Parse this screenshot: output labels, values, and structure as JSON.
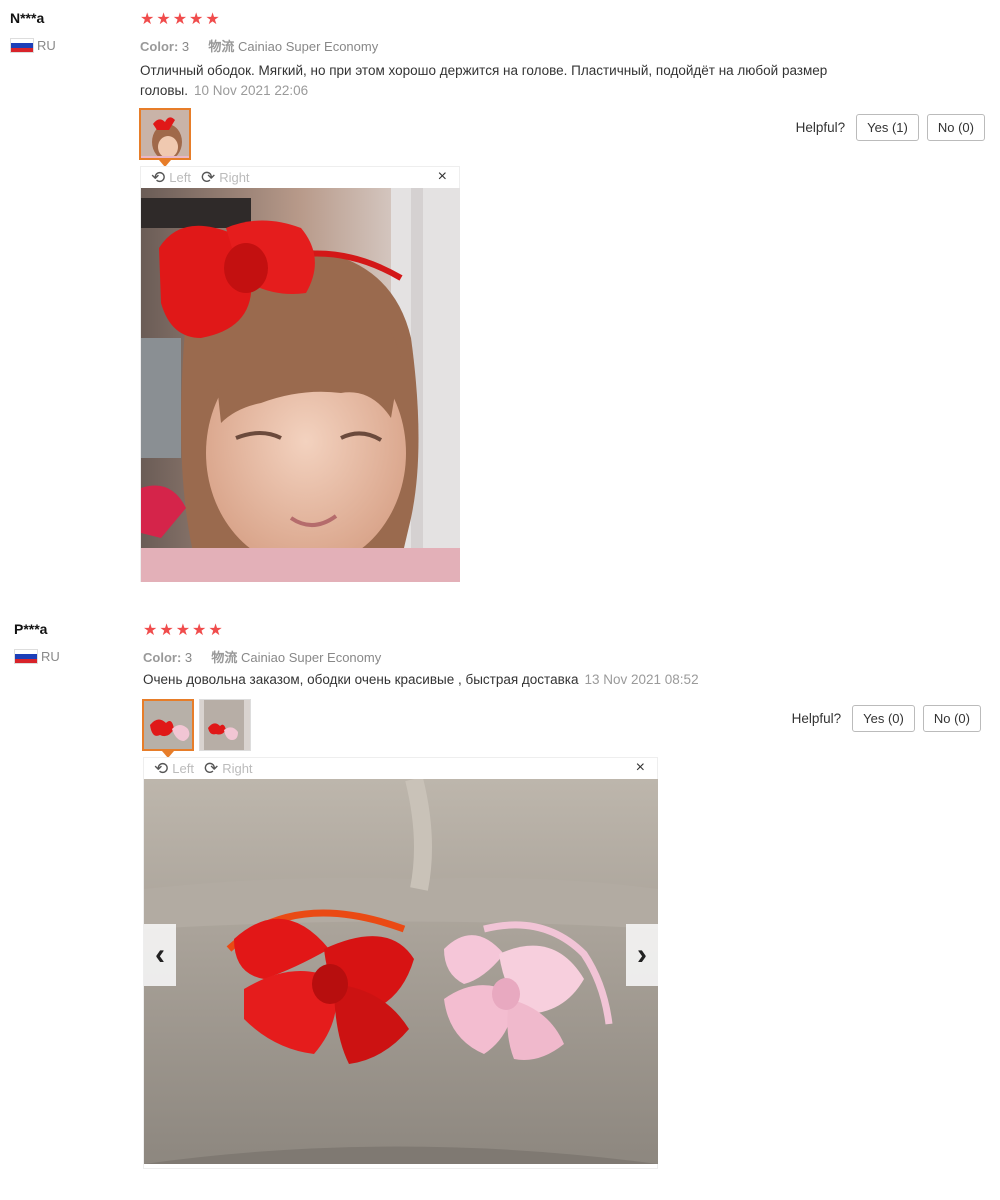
{
  "reviews": [
    {
      "user": "N***a",
      "country": "RU",
      "rating": 5,
      "color_label": "Color:",
      "color_value": "3",
      "logistics_label": "物流",
      "logistics_value": "Cainiao Super Economy",
      "text": "Отличный ободок. Мягкий, но при этом хорошо держится на голове. Пластичный, подойдёт на любой размер головы.",
      "date": "10 Nov 2021 22:06",
      "helpful_label": "Helpful?",
      "yes_label": "Yes (1)",
      "no_label": "No (0)",
      "viewer": {
        "left": "Left",
        "right": "Right",
        "close": "×"
      }
    },
    {
      "user": "P***a",
      "country": "RU",
      "rating": 5,
      "color_label": "Color:",
      "color_value": "3",
      "logistics_label": "物流",
      "logistics_value": "Cainiao Super Economy",
      "text": "Очень довольна заказом, ободки очень красивые , быстрая доставка",
      "date": "13 Nov 2021 08:52",
      "helpful_label": "Helpful?",
      "yes_label": "Yes (0)",
      "no_label": "No (0)",
      "viewer": {
        "left": "Left",
        "right": "Right",
        "close": "×",
        "prev": "‹",
        "next": "›"
      }
    }
  ],
  "colors": {
    "star": "#f04c4c",
    "thumb_active": "#e77d29",
    "muted": "#9a9a9a"
  },
  "icons": {
    "star": "★",
    "rotate_left": "⟲",
    "rotate_right": "⟳"
  }
}
